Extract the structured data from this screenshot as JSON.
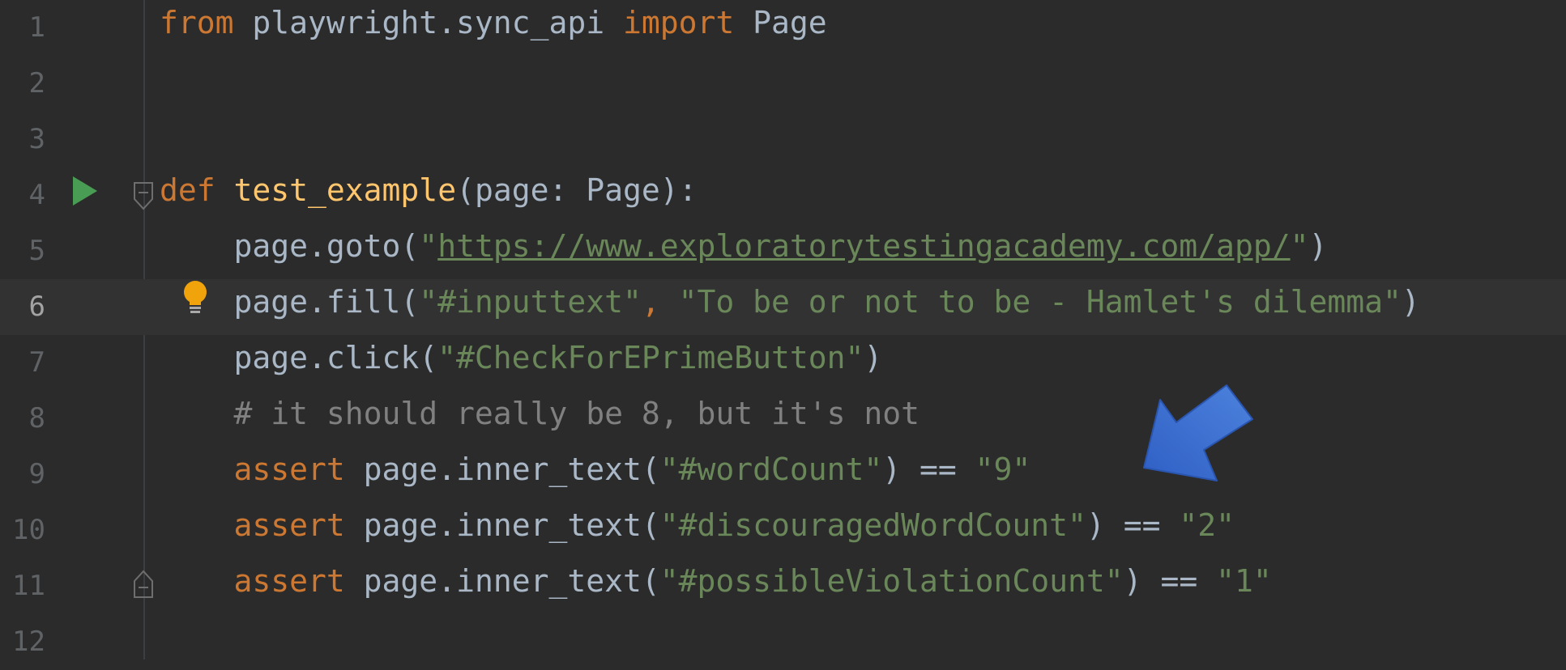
{
  "editor": {
    "lines": [
      {
        "num": "1",
        "tokens": {
          "t1": "from",
          "t2": " playwright.sync_api ",
          "t3": "import",
          "t4": " Page"
        }
      },
      {
        "num": "2"
      },
      {
        "num": "3"
      },
      {
        "num": "4",
        "tokens": {
          "t1": "def",
          "t2": " ",
          "t3": "test_example",
          "t4": "(page: Page):"
        }
      },
      {
        "num": "5",
        "tokens": {
          "t1": "    page.goto(",
          "t2": "\"",
          "t3": "https://www.exploratorytestingacademy.com/app/",
          "t4": "\"",
          "t5": ")"
        }
      },
      {
        "num": "6",
        "tokens": {
          "t1": "    page.fill(",
          "t2": "\"#inputtext\"",
          "t3": ", ",
          "t4": "\"To be or not to be - Hamlet's dilemma\"",
          "t5": ")"
        }
      },
      {
        "num": "7",
        "tokens": {
          "t1": "    page.click(",
          "t2": "\"#CheckForEPrimeButton\"",
          "t3": ")"
        }
      },
      {
        "num": "8",
        "tokens": {
          "t1": "    # it should really be 8, but it's not"
        }
      },
      {
        "num": "9",
        "tokens": {
          "t1": "    ",
          "t2": "assert",
          "t3": " page.inner_text(",
          "t4": "\"#wordCount\"",
          "t5": ") == ",
          "t6": "\"9\""
        }
      },
      {
        "num": "10",
        "tokens": {
          "t1": "    ",
          "t2": "assert",
          "t3": " page.inner_text(",
          "t4": "\"#discouragedWordCount\"",
          "t5": ") == ",
          "t6": "\"2\""
        }
      },
      {
        "num": "11",
        "tokens": {
          "t1": "    ",
          "t2": "assert",
          "t3": " page.inner_text(",
          "t4": "\"#possibleViolationCount\"",
          "t5": ") == ",
          "t6": "\"1\""
        }
      },
      {
        "num": "12"
      }
    ]
  },
  "icons": {
    "run": "run-test-icon",
    "bulb": "lightbulb-intention-icon",
    "fold": "fold-marker-icon",
    "arrow": "blue-arrow-annotation-icon"
  },
  "colors": {
    "background": "#2b2b2b",
    "keyword": "#cc7832",
    "function": "#ffc66d",
    "string": "#6a8759",
    "comment": "#808080",
    "text": "#a9b7c6",
    "run": "#499c54",
    "bulb": "#f0a30a",
    "arrow": "#3a6fd0"
  }
}
